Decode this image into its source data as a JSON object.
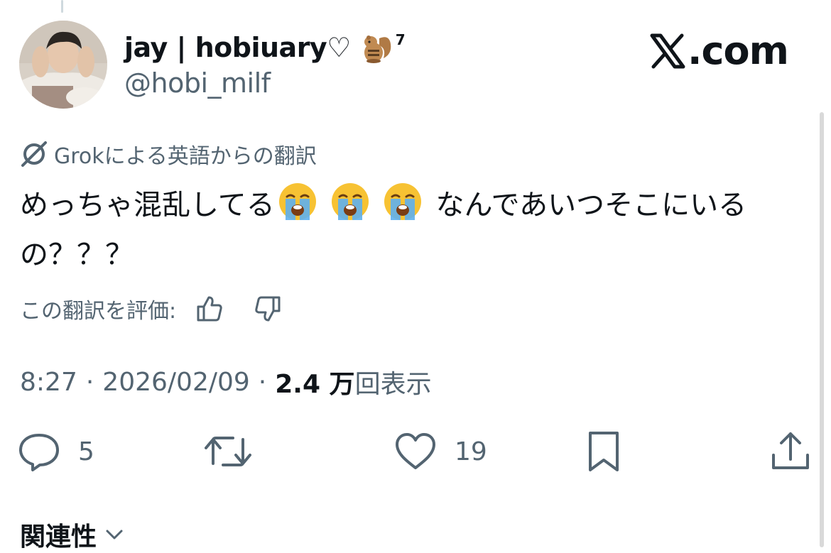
{
  "colors": {
    "text": "#0f1419",
    "muted": "#536471"
  },
  "tweet": {
    "author": {
      "display_name": "jay | hobiuary♡",
      "name_emoji": "chipmunk-emoji",
      "superscript": "7",
      "handle": "@hobi_milf"
    },
    "brand": {
      "x_mark": "𝕏",
      "domain": ".com"
    },
    "translation_notice": "Grokによる英語からの翻訳",
    "text_part1": "めっちゃ混乱してる",
    "text_emojis": [
      "loudly-crying-face-emoji",
      "loudly-crying-face-emoji",
      "loudly-crying-face-emoji"
    ],
    "text_part2": " なんであいつそこにいるの？？？",
    "rate_prompt": "この翻訳を評価:",
    "time": "8:27",
    "separator": "·",
    "date": "2026/02/09",
    "views_count": "2.4 万",
    "views_label": "回表示",
    "actions": {
      "replies": "5",
      "retweets": "",
      "likes": "19"
    },
    "related_label": "関連性"
  }
}
